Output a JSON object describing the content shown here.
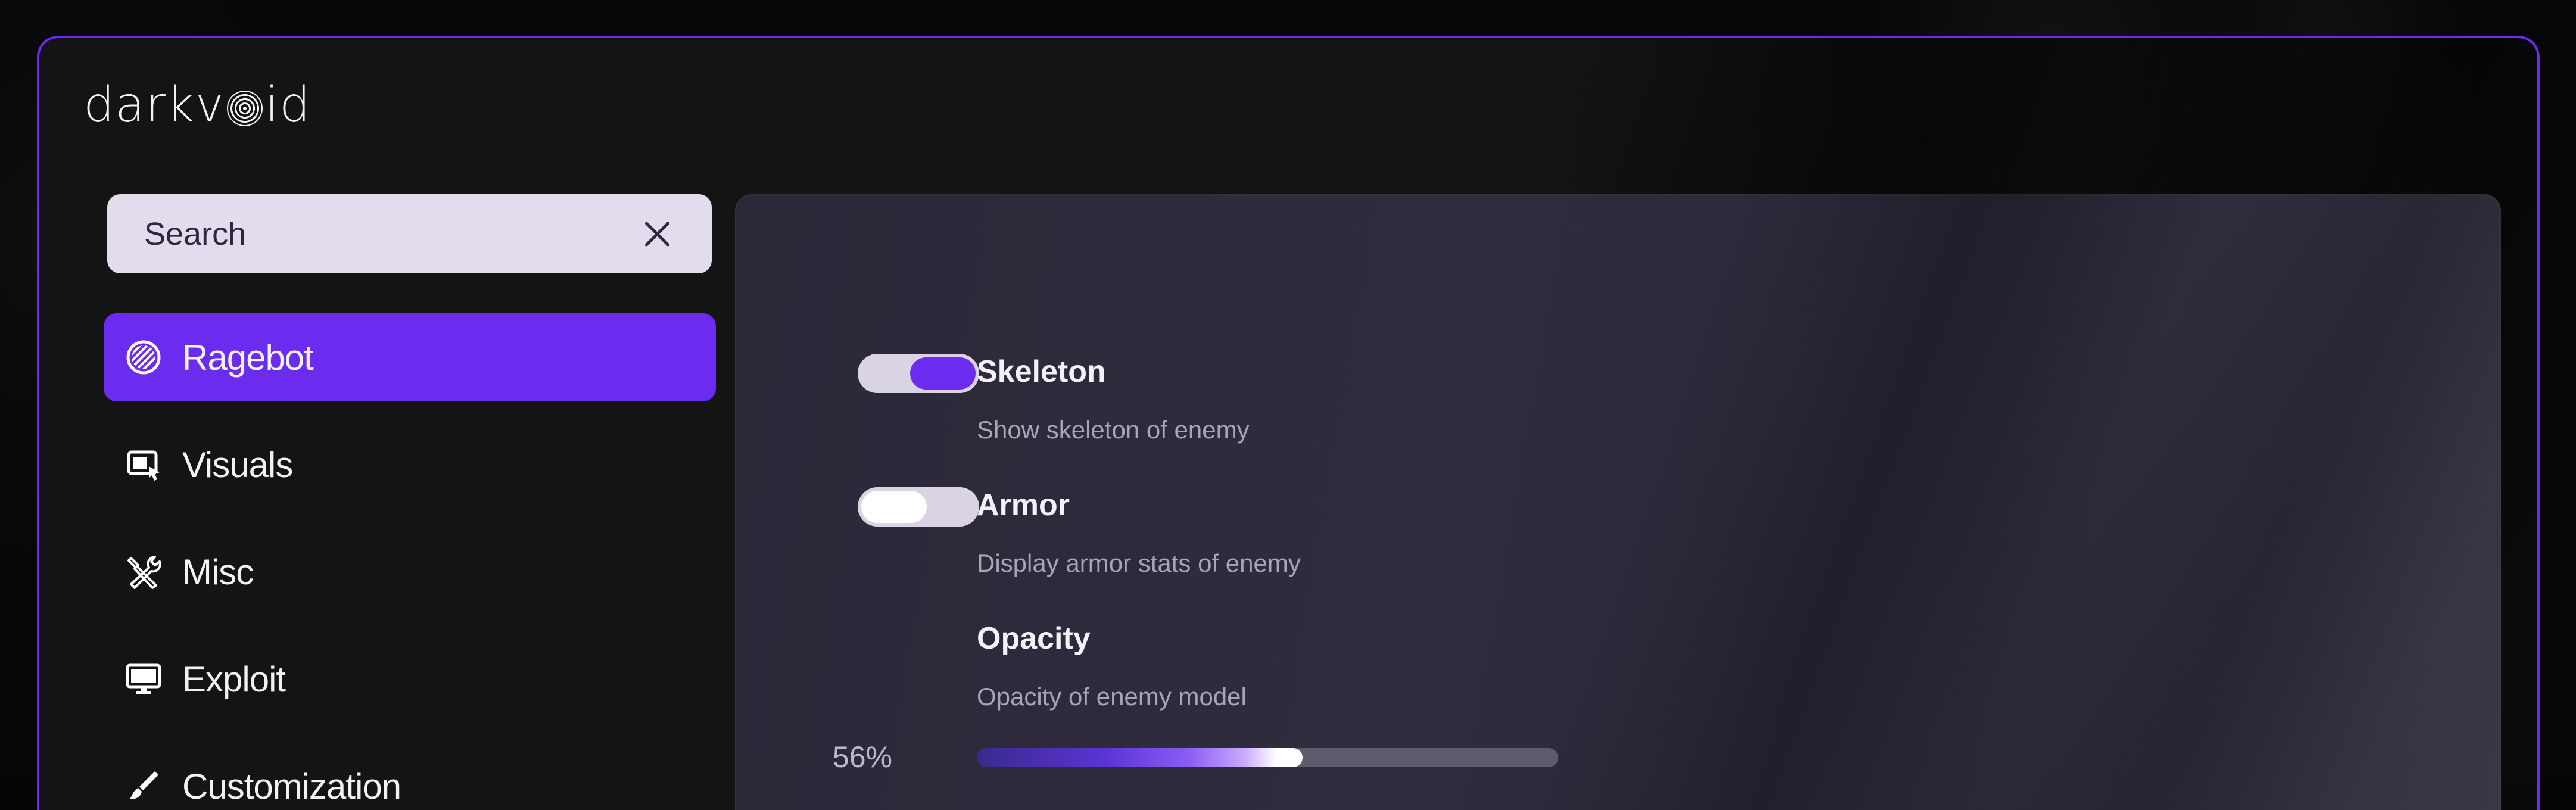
{
  "app": {
    "logo_left": "darkv",
    "logo_right": "id"
  },
  "search": {
    "placeholder": "Search"
  },
  "sidebar": {
    "items": [
      {
        "label": "Ragebot",
        "icon": "ragebot-icon",
        "active": true
      },
      {
        "label": "Visuals",
        "icon": "visuals-icon",
        "active": false
      },
      {
        "label": "Misc",
        "icon": "misc-tools-icon",
        "active": false
      },
      {
        "label": "Exploit",
        "icon": "monitor-icon",
        "active": false
      },
      {
        "label": "Customization",
        "icon": "brush-icon",
        "active": false
      }
    ]
  },
  "settings": {
    "skeleton": {
      "title": "Skeleton",
      "description": "Show skeleton of enemy",
      "enabled": true
    },
    "armor": {
      "title": "Armor",
      "description": "Display armor stats of enemy",
      "enabled": false
    },
    "opacity": {
      "title": "Opacity",
      "description": "Opacity of enemy model",
      "value_label": "56%",
      "value": 0.56
    }
  },
  "colors": {
    "accent": "#6c2cf0",
    "search_bg": "#e3dced",
    "panel_bg": "#2b2838"
  }
}
